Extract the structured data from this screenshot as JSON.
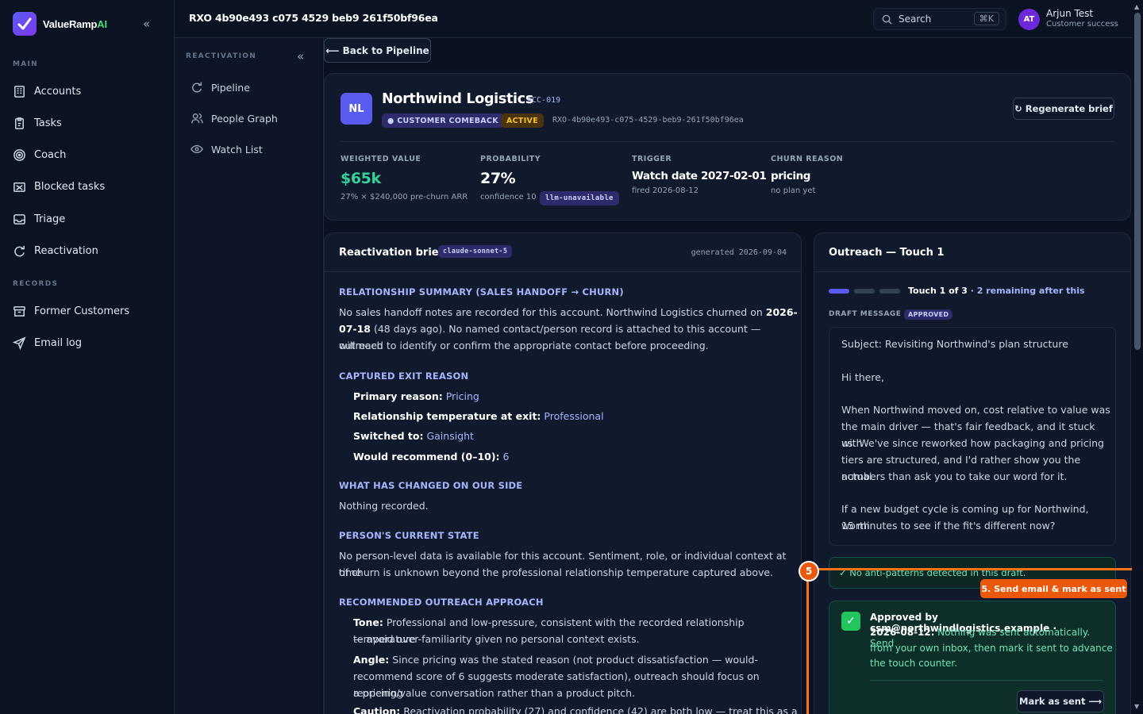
{
  "brand": {
    "name": "ValueRamp",
    "suffix": "AI"
  },
  "sidebar": {
    "main_label": "MAIN",
    "main_items": [
      {
        "label": "Accounts",
        "icon": "building-icon"
      },
      {
        "label": "Tasks",
        "icon": "clipboard-icon"
      },
      {
        "label": "Coach",
        "icon": "target-icon"
      },
      {
        "label": "Blocked tasks",
        "icon": "blocked-icon"
      },
      {
        "label": "Triage",
        "icon": "inbox-icon"
      },
      {
        "label": "Reactivation",
        "icon": "refresh-icon"
      }
    ],
    "records_label": "RECORDS",
    "records_items": [
      {
        "label": "Former Customers",
        "icon": "archive-icon"
      },
      {
        "label": "Email log",
        "icon": "send-icon"
      }
    ]
  },
  "subnav": {
    "label": "REACTIVATION",
    "items": [
      {
        "label": "Pipeline",
        "icon": "refresh-icon"
      },
      {
        "label": "People Graph",
        "icon": "people-icon"
      },
      {
        "label": "Watch List",
        "icon": "eye-icon"
      }
    ]
  },
  "topbar": {
    "title": "RXO 4b90e493 c075 4529 beb9 261f50bf96ea",
    "search_placeholder": "Search",
    "shortcut": "⌘K",
    "user": {
      "initials": "AT",
      "name": "Arjun Test",
      "role": "Customer success"
    }
  },
  "back_label": "⟵ Back to Pipeline",
  "account": {
    "initials": "NL",
    "name": "Northwind Logistics",
    "id": "ACC-019",
    "tag1": "● CUSTOMER COMEBACK",
    "tag2": "ACTIVE",
    "ref": "RXO-4b90e493-c075-4529-beb9-261f50bf96ea",
    "regen_label": "↻ Regenerate brief",
    "stats": [
      {
        "label": "WEIGHTED VALUE",
        "value": "$65k",
        "sub": "27% × $240,000 pre-churn ARR"
      },
      {
        "label": "PROBABILITY",
        "value": "27%",
        "sub": "confidence 10 ·",
        "badge": "llm-unavailable"
      },
      {
        "label": "TRIGGER",
        "value": "Watch date 2027-02-01",
        "sub": "fired 2026-08-12"
      },
      {
        "label": "CHURN REASON",
        "value": "pricing",
        "sub": "no plan yet"
      }
    ]
  },
  "brief": {
    "title": "Reactivation brief",
    "model": "claude-sonnet-5",
    "generated": "generated 2026-09-04",
    "h1": "RELATIONSHIP SUMMARY (SALES HANDOFF → CHURN)",
    "s1_l1a": "No sales handoff notes are recorded for this account. Northwind Logistics churned on ",
    "s1_l1b": "2026-",
    "s1_l2a": "07-18",
    "s1_l2b": " (48 days ago). No named contact/person record is attached to this account — outreach",
    "s1_l3": "will need to identify or confirm the appropriate contact before proceeding.",
    "h2": "CAPTURED EXIT REASON",
    "exit": [
      {
        "k": "Primary reason:",
        "v": "Pricing"
      },
      {
        "k": "Relationship temperature at exit:",
        "v": "Professional"
      },
      {
        "k": "Switched to:",
        "v": "Gainsight"
      },
      {
        "k": "Would recommend (0–10):",
        "v": "6"
      }
    ],
    "h3": "WHAT HAS CHANGED ON OUR SIDE",
    "s3": "Nothing recorded.",
    "h4": "PERSON'S CURRENT STATE",
    "s4_l1": "No person-level data is available for this account. Sentiment, role, or individual context at time",
    "s4_l2": "of churn is unknown beyond the professional relationship temperature captured above.",
    "h5": "RECOMMENDED OUTREACH APPROACH",
    "tone_k": "Tone:",
    "tone_l1": "Professional and low-pressure, consistent with the recorded relationship temperature",
    "tone_l2": "— avoid over-familiarity given no personal context exists.",
    "angle_k": "Angle:",
    "angle_l1": "Since pricing was the stated reason (not product dissatisfaction — would-",
    "angle_l2": "recommend score of 6 suggests moderate satisfaction), outreach should focus on reopening",
    "angle_l3": "a pricing/value conversation rather than a product pitch.",
    "caution_k": "Caution:",
    "caution_l1": "Reactivation probability (27) and confidence (42) are both low — treat this as a"
  },
  "outreach": {
    "title": "Outreach — Touch 1",
    "progress": {
      "current": 1,
      "total": 3
    },
    "touch_label": "Touch 1 of 3",
    "remaining": "· 2 remaining after this",
    "draft_label": "DRAFT MESSAGE",
    "approved_badge": "APPROVED",
    "draft_lines": [
      "Subject: Revisiting Northwind's plan structure",
      "Hi there,",
      "When Northwind moved on, cost relative to value was",
      "the main driver — that's fair feedback, and it stuck with",
      "us. We've since reworked how packaging and pricing",
      "tiers are structured, and I'd rather show you the actual",
      "numbers than ask you to take our word for it.",
      "If a new budget cycle is coming up for Northwind, worth",
      "15 minutes to see if the fit's different now?"
    ],
    "antipattern": "✓ No anti-patterns detected in this draft.",
    "approval_l1": "Approved by csm@northwindlogistics.example ·",
    "approval_l2b": "2026-08-12.",
    "approval_l2": " Nothing was sent automatically. Send",
    "approval_l3": "from your own inbox, then mark it sent to advance",
    "approval_l4": "the touch counter.",
    "mark_sent": "Mark as sent ⟶"
  },
  "step": {
    "number": "5",
    "label": "5. Send email & mark as sent"
  },
  "colors": {
    "accent": "#5b5bf2",
    "green": "#34d399",
    "orange": "#f97316",
    "heading": "#a5b4fc"
  }
}
